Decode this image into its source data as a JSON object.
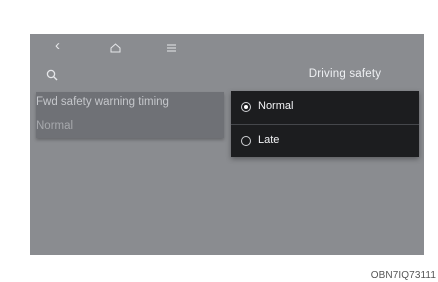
{
  "header": {
    "back_icon": "chevron-left-icon",
    "home_icon": "home-icon",
    "menu_icon": "menu-icon",
    "search_icon": "search-icon",
    "title": "Driving safety"
  },
  "setting": {
    "label": "Fwd safety warning timing",
    "value": "Normal"
  },
  "options": [
    {
      "label": "Normal",
      "selected": true
    },
    {
      "label": "Late",
      "selected": false
    }
  ],
  "caption": "OBN7IQ73111"
}
